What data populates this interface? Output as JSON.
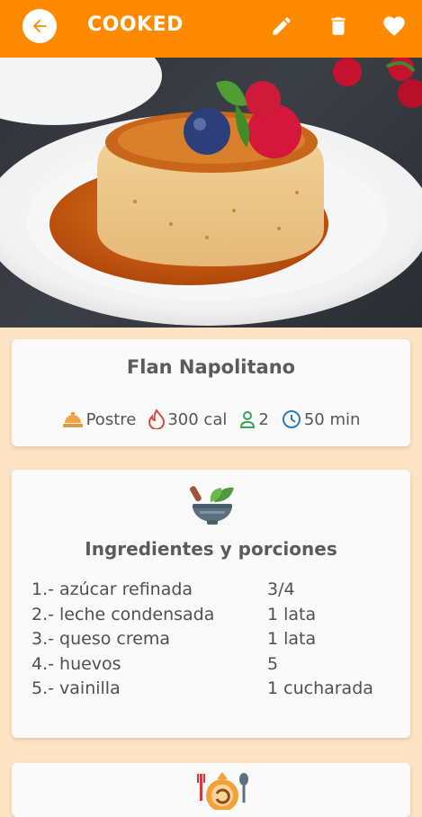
{
  "appbar": {
    "title": "COOKED",
    "back_icon": "arrow-left-icon",
    "actions": [
      "pencil-icon",
      "trash-icon",
      "heart-icon"
    ],
    "color": "#ff8a00"
  },
  "hero": {
    "alt_icon": "flan-dessert-photo"
  },
  "recipe": {
    "name": "Flan Napolitano",
    "category": "Postre",
    "calories": "300 cal",
    "servings": "2",
    "time": "50 min"
  },
  "ingredients": {
    "title": "Ingredientes y porciones",
    "items": [
      {
        "name": "1.- azúcar refinada",
        "qty": "3/4"
      },
      {
        "name": "2.- leche condensada",
        "qty": "1 lata"
      },
      {
        "name": "3.- queso crema",
        "qty": "1 lata"
      },
      {
        "name": "4.- huevos",
        "qty": "5"
      },
      {
        "name": "5.- vainilla",
        "qty": "1 cucharada"
      }
    ]
  },
  "colors": {
    "background": "#fde2c4",
    "accent": "#ff8a00"
  }
}
